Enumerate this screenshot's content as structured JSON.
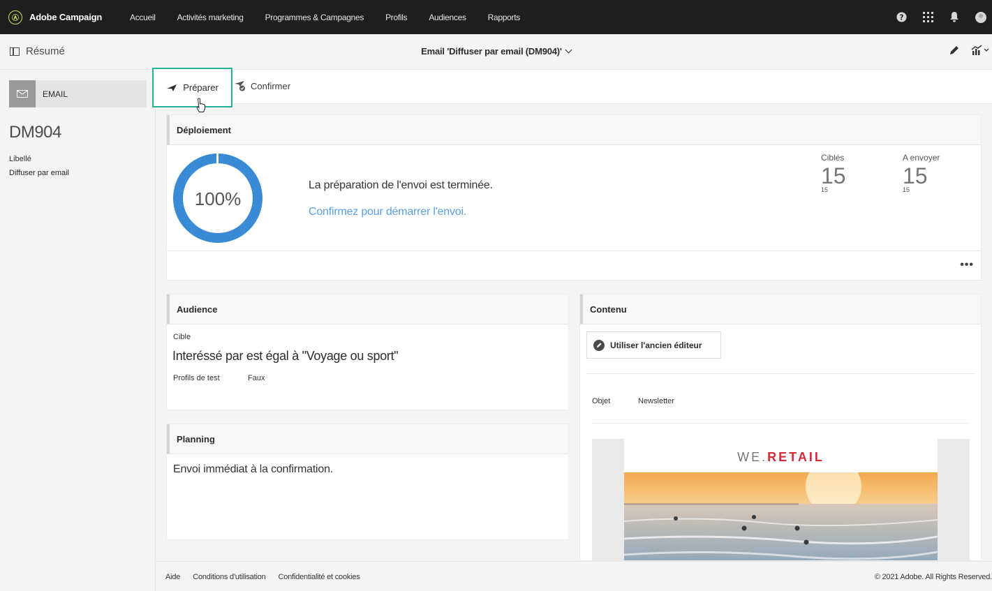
{
  "app": {
    "brand": "Adobe Campaign",
    "logo_glyph": "Ⓐ",
    "accent": "#1fb497",
    "link_color": "#5a9ee0",
    "ring_color": "#3a8bd6"
  },
  "nav": {
    "items": [
      "Accueil",
      "Activités marketing",
      "Programmes & Campagnes",
      "Profils",
      "Audiences",
      "Rapports"
    ]
  },
  "nav_icons": [
    "help-icon",
    "apps-grid-icon",
    "bell-icon",
    "user-avatar-icon"
  ],
  "subheader": {
    "summary": "Résumé",
    "title": "Email 'Diffuser par email (DM904)'"
  },
  "left": {
    "chip_label": "EMAIL",
    "code": "DM904",
    "label_key": "Libellé",
    "label_value": "Diffuser par email"
  },
  "toolbar": {
    "prepare": "Préparer",
    "confirm": "Confirmer"
  },
  "deployment": {
    "title": "Déploiement",
    "progress": 100,
    "progress_text": "100%",
    "message": "La préparation de l'envoi est terminée.",
    "link": "Confirmez pour démarrer l'envoi.",
    "stats": [
      {
        "label": "Ciblés",
        "value": "15",
        "sub": "15"
      },
      {
        "label": "A envoyer",
        "value": "15",
        "sub": "15"
      }
    ],
    "more": "•••"
  },
  "audience": {
    "title": "Audience",
    "cible_label": "Cible",
    "rule": "Interéssé par est égal à \"Voyage ou sport\"",
    "test_key": "Profils de test",
    "test_value": "Faux"
  },
  "planning": {
    "title": "Planning",
    "text": "Envoi immédiat à la confirmation."
  },
  "content": {
    "title": "Contenu",
    "old_editor": "Utiliser l'ancien éditeur",
    "subject_key": "Objet",
    "subject_value": "Newsletter",
    "logo_a": "WE.",
    "logo_b": "RETAIL"
  },
  "footer": {
    "links": [
      "Aide",
      "Conditions d'utilisation",
      "Confidentialité et cookies"
    ],
    "copyright": "© 2021 Adobe. All Rights Reserved."
  }
}
